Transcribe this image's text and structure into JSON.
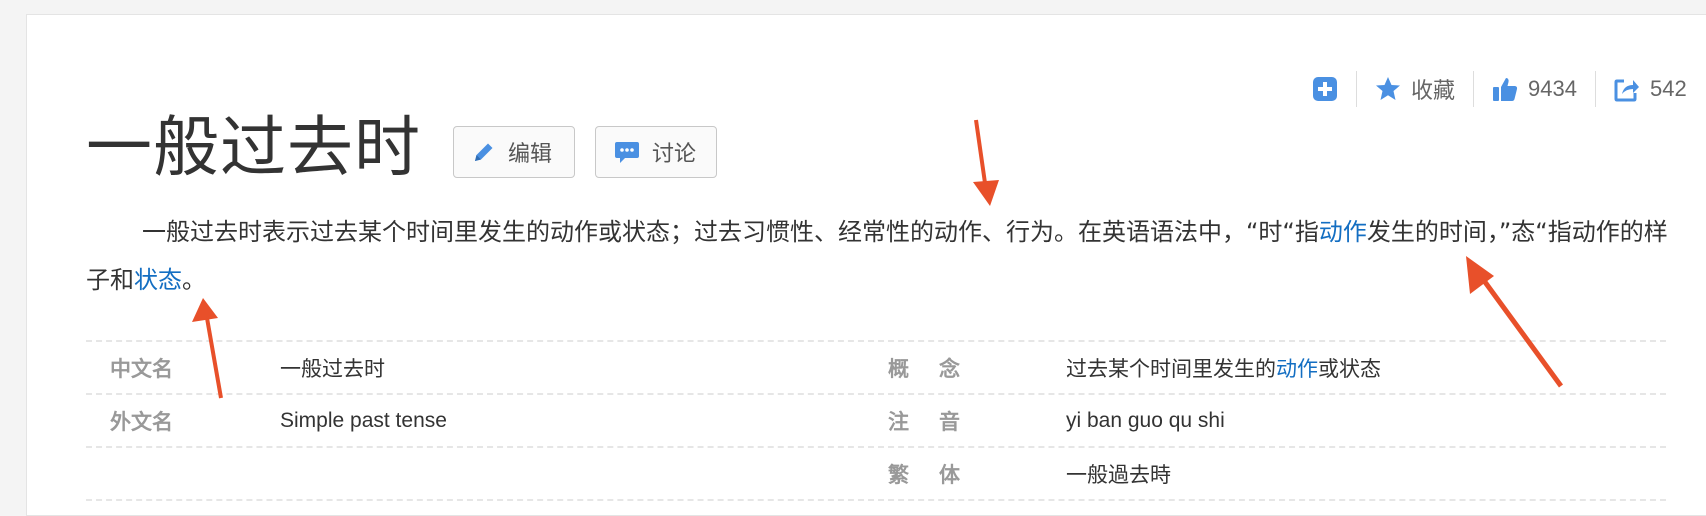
{
  "toolbar": {
    "collect_label": "收藏",
    "like_count": "9434",
    "share_count": "542"
  },
  "title": "一般过去时",
  "buttons": {
    "edit_label": "编辑",
    "discuss_label": "讨论"
  },
  "summary": {
    "part1": "一般过去时表示过去某个时间里发生的动作或状态；过去习惯性、经常性的动作、行为。在英语语法中，“时“指",
    "link1": "动作",
    "part2": "发生的时间，”态“指动作的样子和",
    "link2": "状态",
    "part3": "。"
  },
  "info": {
    "rows": [
      {
        "left_label": "中文名",
        "left_value": "一般过去时",
        "right_label": "概念",
        "right_value_pre": "过去某个时间里发生的",
        "right_value_link": "动作",
        "right_value_post": "或状态"
      },
      {
        "left_label": "外文名",
        "left_value": "Simple past tense",
        "right_label": "注音",
        "right_value": "yi ban guo qu shi"
      },
      {
        "left_label": "",
        "left_value": "",
        "right_label": "繁体",
        "right_value": "一般過去時"
      }
    ]
  },
  "colors": {
    "accent_blue": "#4a90e2",
    "link_blue": "#136ec2",
    "annotation_red": "#e8502a"
  },
  "icons": [
    "add-icon",
    "star-icon",
    "thumbs-up-icon",
    "share-icon",
    "pencil-icon",
    "chat-bubble-icon"
  ]
}
